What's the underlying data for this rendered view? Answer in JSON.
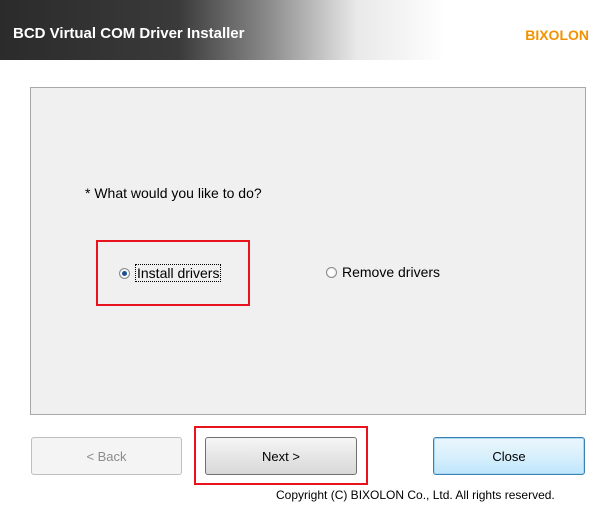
{
  "header": {
    "title": "BCD Virtual COM Driver Installer",
    "brand": "BIXOLON"
  },
  "main": {
    "question": "* What would you like to do?",
    "options": [
      {
        "label": "Install drivers",
        "selected": true
      },
      {
        "label": "Remove drivers",
        "selected": false
      }
    ]
  },
  "buttons": {
    "back": "< Back",
    "next": "Next >",
    "close": "Close"
  },
  "footer": {
    "copyright": "Copyright (C) BIXOLON Co., Ltd. All rights reserved."
  },
  "colors": {
    "brand": "#f39200",
    "highlight": "#e8131c",
    "primary_button_border": "#3c7fb1"
  }
}
